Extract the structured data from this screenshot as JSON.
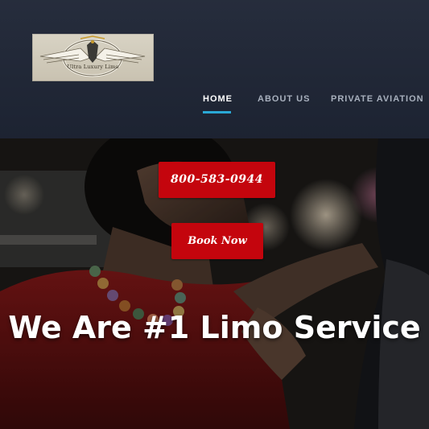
{
  "header": {
    "logo": {
      "text": "Ultra Luxury Limo",
      "icon": "winged-emblem-logo"
    },
    "nav": [
      {
        "label": "HOME",
        "active": true
      },
      {
        "label": "ABOUT US",
        "active": false
      },
      {
        "label": "PRIVATE AVIATION",
        "active": false
      }
    ]
  },
  "hero": {
    "phone_button": "800-583-0944",
    "book_button": "Book Now",
    "headline": "We Are #1 Limo Service",
    "image": "couple-in-limousine-photo"
  },
  "colors": {
    "header_bg": "#1f2636",
    "accent_underline": "#2aa8d6",
    "button_red": "#c4050d",
    "nav_text": "#a8b0bd"
  }
}
